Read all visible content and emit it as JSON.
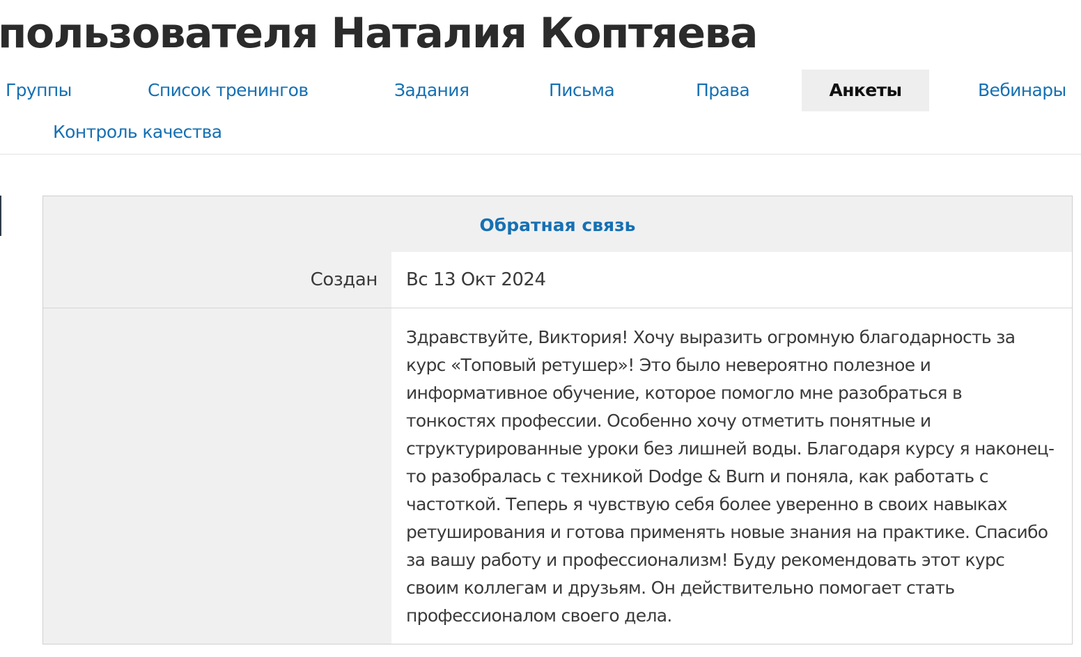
{
  "header": {
    "title": "пользователя Наталия Коптяева"
  },
  "tabs": [
    {
      "label": "Группы",
      "active": false
    },
    {
      "label": "Список тренингов",
      "active": false
    },
    {
      "label": "Задания",
      "active": false
    },
    {
      "label": "Письма",
      "active": false
    },
    {
      "label": "Права",
      "active": false
    },
    {
      "label": "Анкеты",
      "active": true
    },
    {
      "label": "Вебинары",
      "active": false
    },
    {
      "label": "Контроль качества",
      "active": false
    }
  ],
  "survey": {
    "title": "Обратная связь",
    "created_label": "Создан",
    "created_value": "Вс 13 Окт 2024",
    "feedback_label": "",
    "feedback_text": "Здравствуйте, Виктория! Хочу выразить огромную благодарность за курс «Топовый ретушер»! Это было невероятно полезное и информативное обучение, которое помогло мне разобраться в тонкостях профессии. Особенно хочу отметить понятные и структурированные уроки без лишней воды. Благодаря курсу я наконец-то разобралась с техникой Dodge & Burn и поняла, как работать с частоткой. Теперь я чувствую себя более уверенно в своих навыках ретуширования и готова применять новые знания на практике. Спасибо за вашу работу и профессионализм! Буду рекомендовать этот курс своим коллегам и друзьям. Он действительно помогает стать профессионалом своего дела."
  },
  "colors": {
    "link": "#1670b3",
    "active_tab_bg": "#eeeeee",
    "label_bg": "#f0f0f0"
  }
}
